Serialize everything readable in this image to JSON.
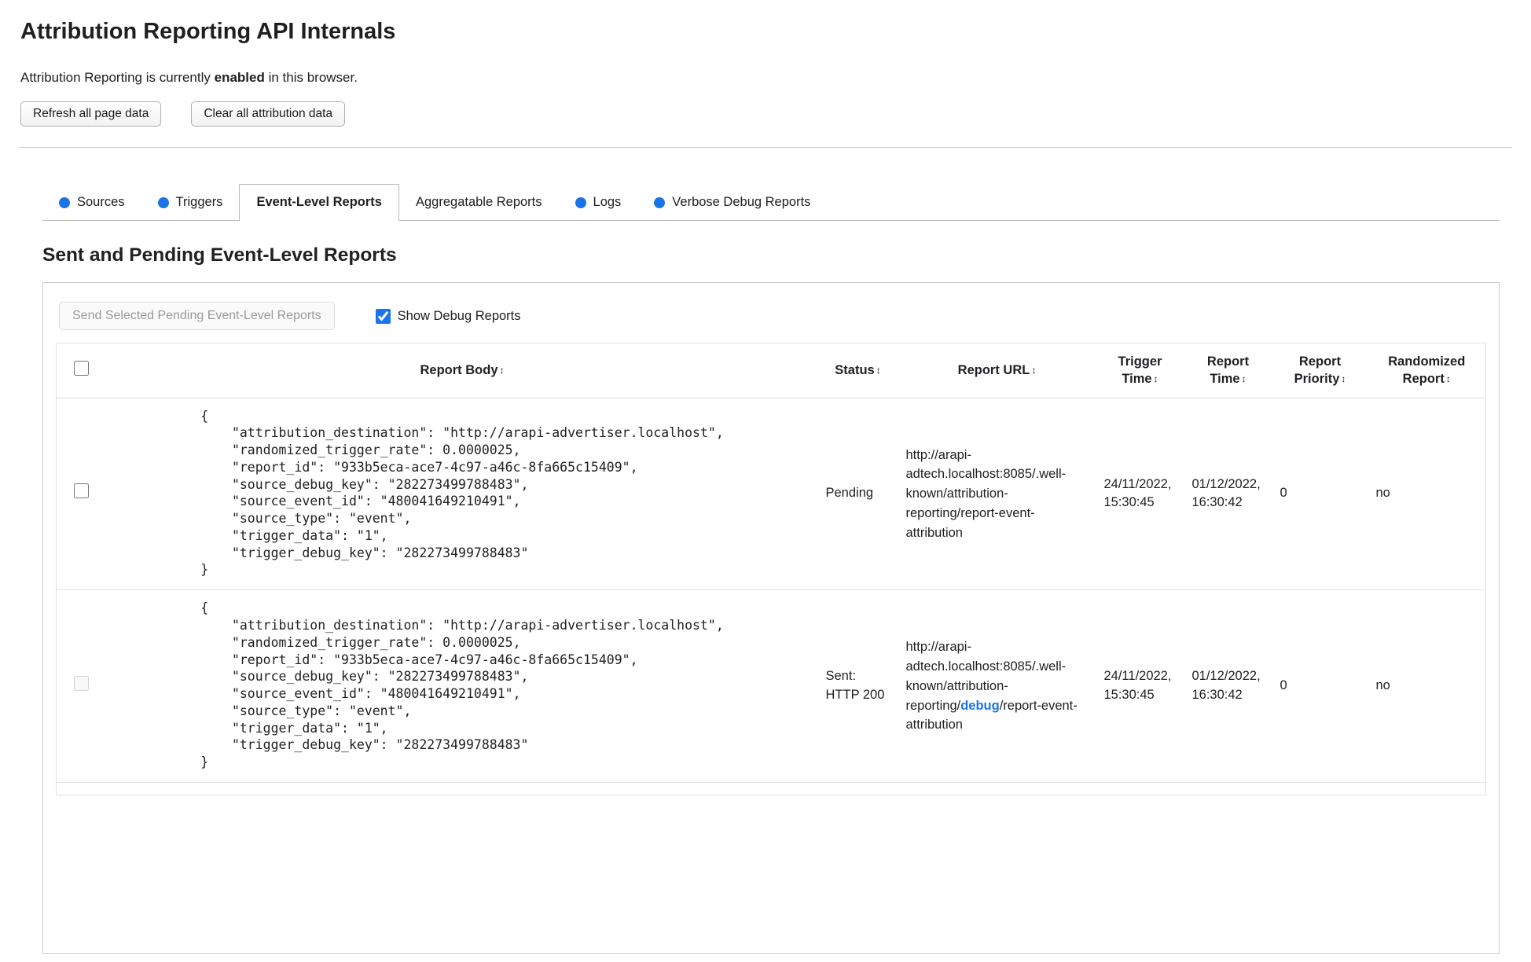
{
  "header": {
    "title": "Attribution Reporting API Internals",
    "status_prefix": "Attribution Reporting is currently ",
    "status_emphasis": "enabled",
    "status_suffix": " in this browser."
  },
  "toolbar": {
    "refresh_label": "Refresh all page data",
    "clear_label": "Clear all attribution data"
  },
  "tabs": {
    "items": [
      {
        "label": "Sources",
        "has_dot": true,
        "active": false
      },
      {
        "label": "Triggers",
        "has_dot": true,
        "active": false
      },
      {
        "label": "Event-Level Reports",
        "has_dot": false,
        "active": true
      },
      {
        "label": "Aggregatable Reports",
        "has_dot": false,
        "active": false
      },
      {
        "label": "Logs",
        "has_dot": true,
        "active": false
      },
      {
        "label": "Verbose Debug Reports",
        "has_dot": true,
        "active": false
      }
    ]
  },
  "section": {
    "heading": "Sent and Pending Event-Level Reports"
  },
  "controls": {
    "send_button_label": "Send Selected Pending Event-Level Reports",
    "show_debug_label": "Show Debug Reports",
    "show_debug_checked": true
  },
  "table": {
    "sort_icon": "↕",
    "headers": [
      "Report Body",
      "Status",
      "Report URL",
      "Trigger Time",
      "Report Time",
      "Report Priority",
      "Randomized Report"
    ],
    "rows": [
      {
        "report_body": "{\n    \"attribution_destination\": \"http://arapi-advertiser.localhost\",\n    \"randomized_trigger_rate\": 0.0000025,\n    \"report_id\": \"933b5eca-ace7-4c97-a46c-8fa665c15409\",\n    \"source_debug_key\": \"282273499788483\",\n    \"source_event_id\": \"480041649210491\",\n    \"source_type\": \"event\",\n    \"trigger_data\": \"1\",\n    \"trigger_debug_key\": \"282273499788483\"\n}",
        "status": "Pending",
        "url": "http://arapi-adtech.localhost:8085/.well-known/attribution-reporting/report-event-attribution",
        "trigger_time": "24/11/2022, 15:30:45",
        "report_time": "01/12/2022, 16:30:42",
        "report_priority": "0",
        "randomized_report": "no"
      },
      {
        "report_body": "{\n    \"attribution_destination\": \"http://arapi-advertiser.localhost\",\n    \"randomized_trigger_rate\": 0.0000025,\n    \"report_id\": \"933b5eca-ace7-4c97-a46c-8fa665c15409\",\n    \"source_debug_key\": \"282273499788483\",\n    \"source_event_id\": \"480041649210491\",\n    \"source_type\": \"event\",\n    \"trigger_data\": \"1\",\n    \"trigger_debug_key\": \"282273499788483\"\n}",
        "status": "Sent: HTTP 200",
        "url_prefix": "http://arapi-adtech.localhost:8085/.well-known/attribution-reporting/",
        "url_debug": "debug",
        "url_suffix": "/report-event-attribution",
        "trigger_time": "24/11/2022, 15:30:45",
        "report_time": "01/12/2022, 16:30:42",
        "report_priority": "0",
        "randomized_report": "no"
      }
    ]
  },
  "colors": {
    "tab_dot_blue": "#1a73e8",
    "debug_link_blue": "#1a73e8",
    "checkbox_accent": "#1a73e8"
  }
}
